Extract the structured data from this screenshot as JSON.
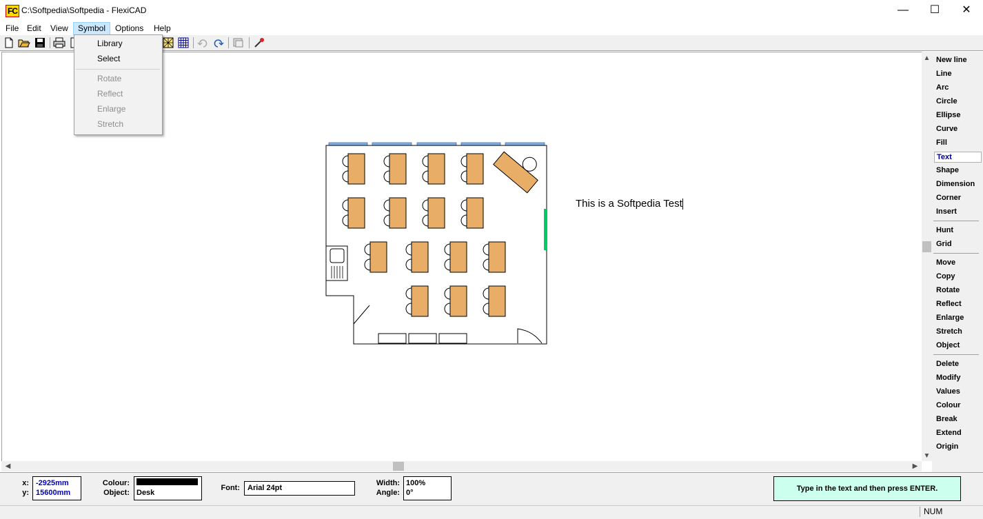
{
  "window": {
    "title": "C:\\Softpedia\\Softpedia - FlexiCAD",
    "app_icon_text": "FC",
    "minimize": "—",
    "maximize": "☐",
    "close": "✕"
  },
  "menubar": {
    "items": [
      "File",
      "Edit",
      "View",
      "Symbol",
      "Options",
      "Help"
    ]
  },
  "symbol_menu": {
    "items": [
      {
        "label": "Library",
        "enabled": true
      },
      {
        "label": "Select",
        "enabled": true
      },
      {
        "label": "Rotate",
        "enabled": false
      },
      {
        "label": "Reflect",
        "enabled": false
      },
      {
        "label": "Enlarge",
        "enabled": false
      },
      {
        "label": "Stretch",
        "enabled": false
      }
    ]
  },
  "toolbar": {
    "icons": [
      "new-file-icon",
      "open-folder-icon",
      "save-icon",
      "print-icon",
      "preview-icon",
      "hatch-icon",
      "grid-icon",
      "undo-icon",
      "redo-icon",
      "copy-screen-icon",
      "eyedropper-icon"
    ]
  },
  "canvas": {
    "text_entry": "This is a Softpedia Test"
  },
  "commands": {
    "group1": [
      "New line",
      "Line",
      "Arc",
      "Circle",
      "Ellipse",
      "Curve",
      "Fill",
      "Text",
      "Shape",
      "Dimension",
      "Corner",
      "Insert"
    ],
    "group2": [
      "Hunt",
      "Grid"
    ],
    "group3": [
      "Move",
      "Copy",
      "Rotate",
      "Reflect",
      "Enlarge",
      "Stretch",
      "Object"
    ],
    "group4": [
      "Delete",
      "Modify",
      "Values",
      "Colour",
      "Break",
      "Extend",
      "Origin"
    ],
    "selected": "Text"
  },
  "status": {
    "x_label": "x:",
    "x_value": "-2925mm",
    "y_label": "y:",
    "y_value": "15600mm",
    "colour_label": "Colour:",
    "colour_value": "#000000",
    "object_label": "Object:",
    "object_value": "Desk",
    "font_label": "Font:",
    "font_value": "Arial 24pt",
    "width_label": "Width:",
    "width_value": "100%",
    "angle_label": "Angle:",
    "angle_value": "0°",
    "hint": "Type in the text and then press ENTER.",
    "num": "NUM"
  },
  "colors": {
    "desk": "#e8ad66",
    "window_blue": "#7fb2e6",
    "door_green": "#00cc66",
    "hint_bg": "#ccffee",
    "coord_blue": "#0000c0"
  }
}
